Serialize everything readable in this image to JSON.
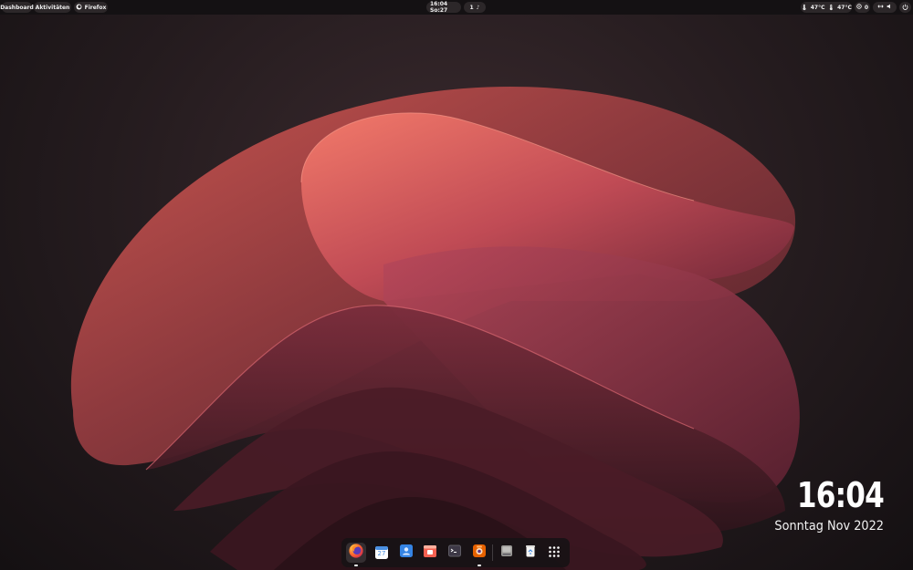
{
  "topbar": {
    "dashboard_label": "Dashboard",
    "activities_label": "Aktivitäten",
    "app_label": "Firefox",
    "clock_label": "16:04 So:27",
    "workspace_number": "1",
    "temp_cpu": "47°C",
    "temp_gpu": "47°C",
    "notifications_count": "0"
  },
  "desktop_clock": {
    "time": "16:04",
    "date": "Sonntag Nov 2022"
  },
  "calendar_icon_day": "27",
  "dock": {
    "apps": [
      {
        "name": "Firefox",
        "running": true
      },
      {
        "name": "Calendar",
        "running": false
      },
      {
        "name": "Contacts",
        "running": false
      },
      {
        "name": "Software",
        "running": false
      },
      {
        "name": "Terminal",
        "running": false
      },
      {
        "name": "Screenshot",
        "running": true
      },
      {
        "name": "Drive",
        "running": false
      },
      {
        "name": "Trash",
        "running": false
      },
      {
        "name": "Show Applications",
        "running": false
      }
    ]
  },
  "colors": {
    "accent": "#e8605a",
    "topbar_bg": "#141113",
    "pill_bg": "#2c2729"
  }
}
